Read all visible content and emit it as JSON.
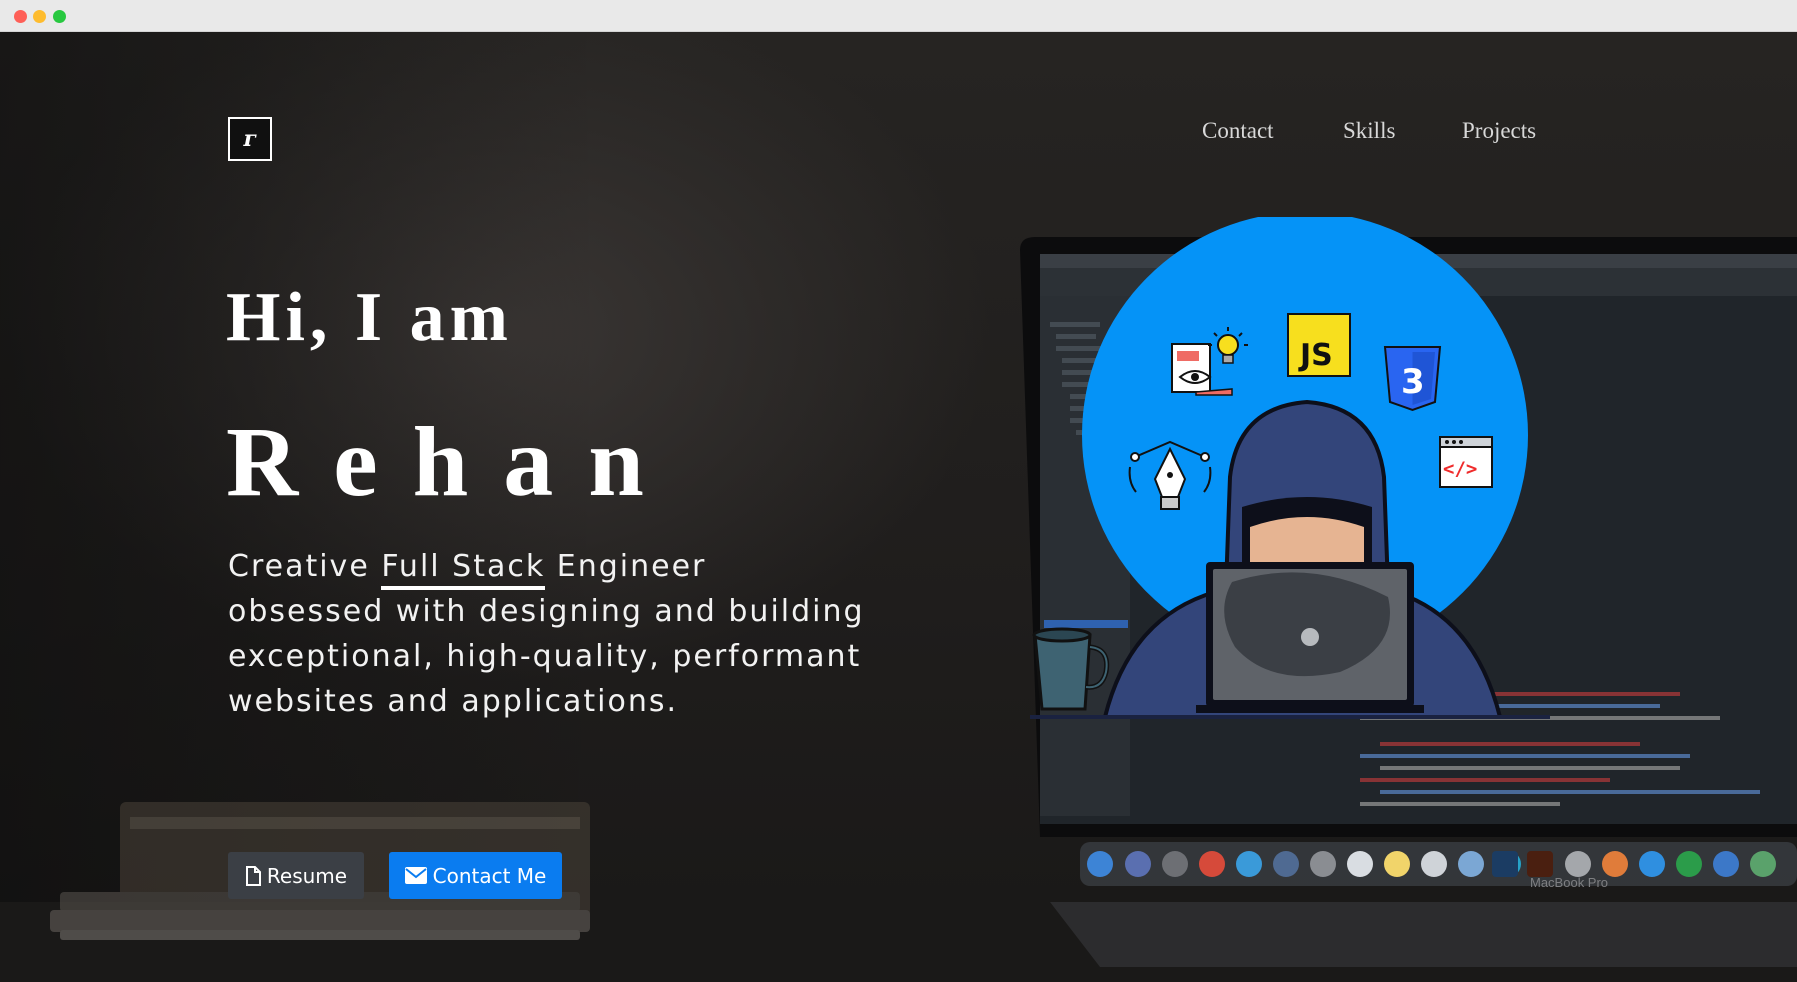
{
  "nav": {
    "logo": "ᴦ",
    "links": [
      "Contact",
      "Skills",
      "Projects"
    ]
  },
  "hero": {
    "greeting": "Hi, I am",
    "name": "Rehan",
    "tagline_before": "Creative ",
    "tagline_highlight": "Full Stack",
    "tagline_after": " Engineer obsessed with designing and building exceptional, high-quality, performant websites and applications."
  },
  "buttons": {
    "resume": "Resume",
    "contact": "Contact Me"
  },
  "illustration": {
    "js_badge": "JS",
    "css_badge": "3",
    "code_tag": "</>"
  },
  "laptop_brand": "MacBook Pro",
  "colors": {
    "accent": "#0a7cf0",
    "illustration_circle": "#0593f7",
    "js_yellow": "#f7df1e",
    "css_blue": "#2965f1"
  },
  "icons": [
    "file-icon",
    "envelope-icon",
    "js-icon",
    "css3-icon",
    "code-window-icon",
    "pen-tool-icon",
    "design-doc-icon",
    "lightbulb-icon",
    "coffee-mug-icon"
  ]
}
